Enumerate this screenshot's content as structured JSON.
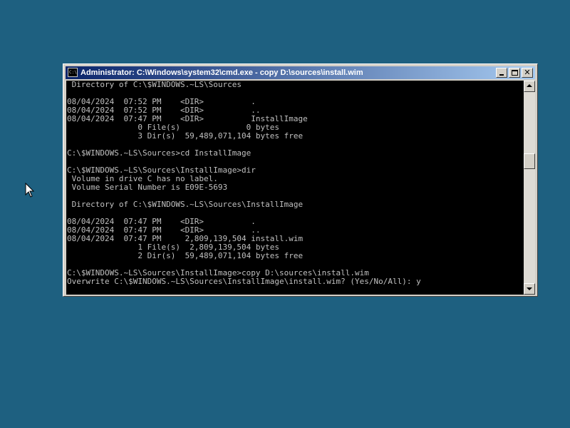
{
  "window": {
    "title": "Administrator: C:\\Windows\\system32\\cmd.exe - copy  D:\\sources\\install.wim",
    "icon": "cmd-icon",
    "icon_text": "C:\\",
    "buttons": [
      "minimize",
      "maximize",
      "close"
    ],
    "close_glyph": "✕"
  },
  "console": {
    "foreground": "#c0c0c0",
    "background": "#000000",
    "lines": [
      " Directory of C:\\$WINDOWS.~LS\\Sources",
      "",
      "08/04/2024  07:52 PM    <DIR>          .",
      "08/04/2024  07:52 PM    <DIR>          ..",
      "08/04/2024  07:47 PM    <DIR>          InstallImage",
      "               0 File(s)              0 bytes",
      "               3 Dir(s)  59,489,071,104 bytes free",
      "",
      "C:\\$WINDOWS.~LS\\Sources>cd InstallImage",
      "",
      "C:\\$WINDOWS.~LS\\Sources\\InstallImage>dir",
      " Volume in drive C has no label.",
      " Volume Serial Number is E09E-5693",
      "",
      " Directory of C:\\$WINDOWS.~LS\\Sources\\InstallImage",
      "",
      "08/04/2024  07:47 PM    <DIR>          .",
      "08/04/2024  07:47 PM    <DIR>          ..",
      "08/04/2024  07:47 PM     2,809,139,504 install.wim",
      "               1 File(s)  2,809,139,504 bytes",
      "               2 Dir(s)  59,489,071,104 bytes free",
      "",
      "C:\\$WINDOWS.~LS\\Sources\\InstallImage>copy D:\\sources\\install.wim",
      "Overwrite C:\\$WINDOWS.~LS\\Sources\\InstallImage\\install.wim? (Yes/No/All): y"
    ]
  },
  "scrollbar": {
    "up_icon": "arrow-up-icon",
    "down_icon": "arrow-down-icon",
    "position": 0.35
  },
  "desktop": {
    "background": "#1e6080",
    "cursor": "mouse-pointer-icon"
  }
}
